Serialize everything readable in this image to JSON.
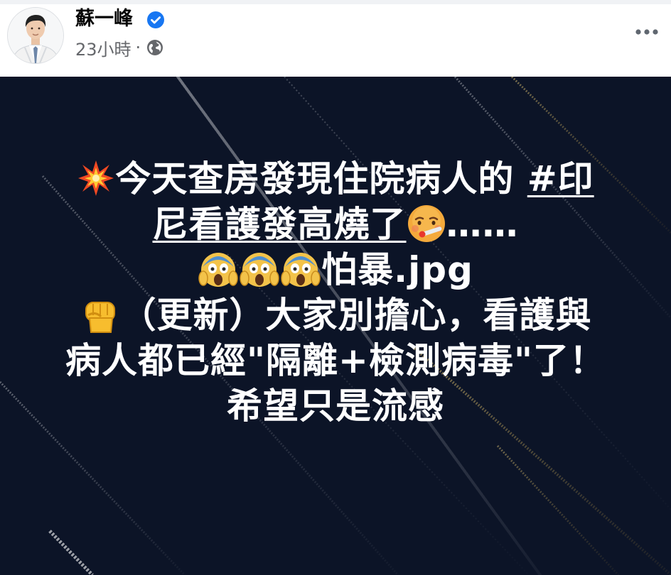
{
  "post": {
    "author_name": "蘇一峰",
    "time": "23小時",
    "separator": "·",
    "verified_icon": "verified-badge-icon",
    "privacy_icon": "globe-icon",
    "more_icon": "more-options-icon"
  },
  "status": {
    "background_color": "#0c1427",
    "text_color": "#ffffff",
    "line1_text": "今天查房發現住院病人的 ",
    "line1_hashtag": "#印",
    "line2_hashtag": "尼看護發高燒了",
    "line2_tail": "……",
    "line3_text": "怕暴.jpg",
    "line4_text": "（更新）大家別擔心，看護與",
    "line5_text": "病人都已經\"隔離+檢測病毒\"了！",
    "line6_text": "希望只是流感",
    "emojis": [
      "collision-icon",
      "face-with-thermometer-icon",
      "face-screaming-icon",
      "raised-fist-icon"
    ]
  }
}
